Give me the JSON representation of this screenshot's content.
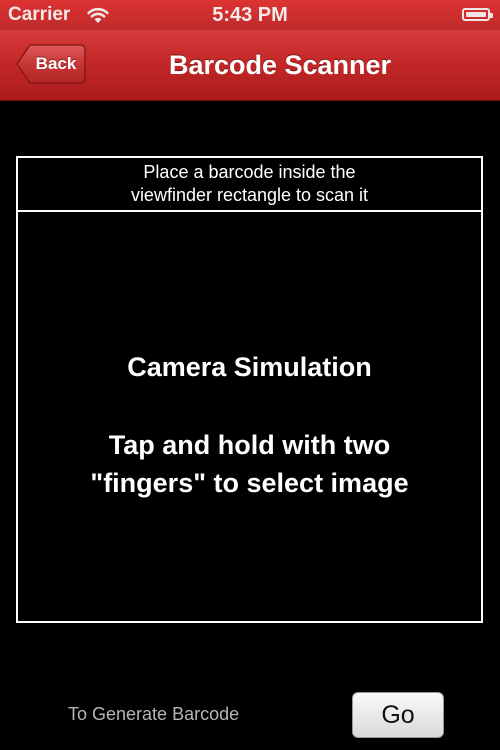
{
  "status_bar": {
    "carrier": "Carrier",
    "time": "5:43 PM",
    "battery_level": 1.0
  },
  "nav_bar": {
    "back_label": "Back",
    "title": "Barcode Scanner"
  },
  "scanner": {
    "instructions_line1": "Place a barcode inside the",
    "instructions_line2": "viewfinder rectangle to scan it",
    "camera_title": "Camera Simulation",
    "camera_hint_line1": "Tap and hold with two",
    "camera_hint_line2": "\"fingers\" to select image"
  },
  "footer": {
    "generate_label": "To Generate Barcode",
    "go_label": "Go"
  },
  "colors": {
    "nav_red": "#c42828",
    "background": "#000000",
    "text": "#ffffff"
  },
  "icons": [
    "wifi-icon",
    "battery-icon",
    "back-arrow-button"
  ]
}
